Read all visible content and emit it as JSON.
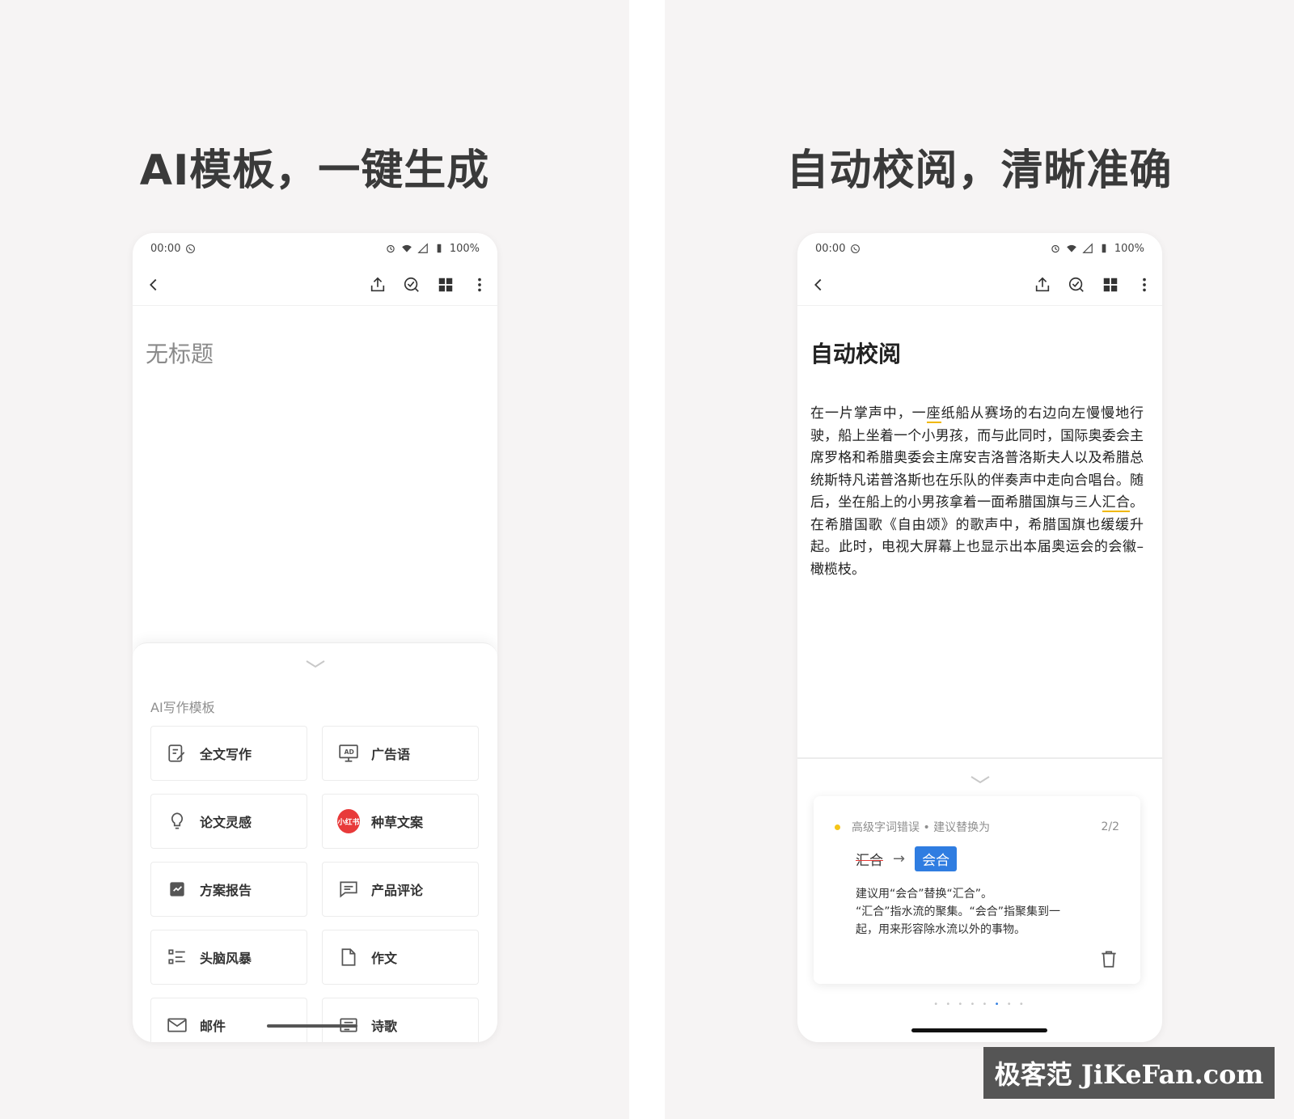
{
  "colors": {
    "accent_blue": "#2f7de1",
    "highlight_yellow": "#f0b800",
    "error_red": "#e53935",
    "xhs_red": "#e83a3a"
  },
  "left": {
    "headline": "AI模板，一键生成",
    "status": {
      "time": "00:00",
      "battery": "100%"
    },
    "doc_title": "无标题",
    "sheet_label": "AI写作模板",
    "templates": [
      {
        "label": "全文写作",
        "icon": "edit-doc-icon"
      },
      {
        "label": "广告语",
        "icon": "ad-board-icon"
      },
      {
        "label": "论文灵感",
        "icon": "lightbulb-icon"
      },
      {
        "label": "种草文案",
        "icon": "xiaohongshu-icon",
        "badge": "小红书"
      },
      {
        "label": "方案报告",
        "icon": "report-icon"
      },
      {
        "label": "产品评论",
        "icon": "comment-icon"
      },
      {
        "label": "头脑风暴",
        "icon": "list-icon"
      },
      {
        "label": "作文",
        "icon": "document-icon"
      },
      {
        "label": "邮件",
        "icon": "mail-icon"
      },
      {
        "label": "诗歌",
        "icon": "poem-icon"
      }
    ]
  },
  "right": {
    "headline": "自动校阅，清晰准确",
    "status": {
      "time": "00:00",
      "battery": "100%"
    },
    "doc_title": "自动校阅",
    "body": {
      "part1": "在一片掌声中，一",
      "hl1": "座",
      "part2": "纸船从赛场的右边向左慢慢地行驶，船上坐着一个小男孩，而与此同时，国际奥委会主席罗格和希腊奥委会主席安吉洛普洛斯夫人以及希腊总统斯特凡诺普洛斯也在乐队的伴奏声中走向合唱台。随后，坐在船上的小男孩拿着一面希腊国旗与三人",
      "hl2": "汇合",
      "part3": "。在希腊国歌《自由颂》的歌声中，希腊国旗也缓缓升起。此时，电视大屏幕上也显示出本届奥运会的会徽–橄榄枝。"
    },
    "proof": {
      "category": "高级字词错误 • 建议替换为",
      "count": "2/2",
      "wrong": "汇合",
      "arrow": "→",
      "suggestion": "会合",
      "desc_line1": "建议用“会合”替换“汇合”。",
      "desc_line2": "“汇合”指水流的聚集。“会合”指聚集到一起，用来形容除水流以外的事物。"
    },
    "pager": {
      "before": "• • • • •",
      "active": "•",
      "after": "• •"
    }
  },
  "watermark": "极客范 JiKeFan.com"
}
